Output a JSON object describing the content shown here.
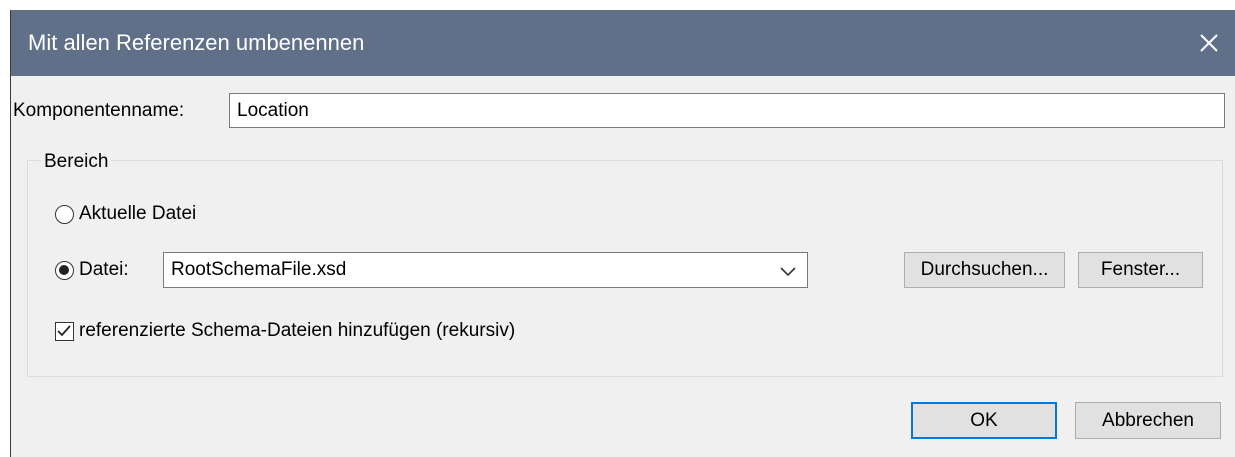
{
  "dialog": {
    "title": "Mit allen Referenzen umbenennen",
    "close_icon": "close-icon"
  },
  "component": {
    "label": "Komponentenname:",
    "value": "Location"
  },
  "scope": {
    "group_label": "Bereich",
    "current_file_label": "Aktuelle Datei",
    "current_file_selected": false,
    "file_label": "Datei:",
    "file_selected": true,
    "file_value": "RootSchemaFile.xsd",
    "browse_label": "Durchsuchen...",
    "window_label": "Fenster...",
    "include_label": "referenzierte Schema-Dateien hinzufügen (rekursiv)",
    "include_checked": true
  },
  "footer": {
    "ok_label": "OK",
    "cancel_label": "Abbrechen"
  },
  "colors": {
    "titlebar": "#5f7088",
    "default_button_border": "#0078d7"
  }
}
